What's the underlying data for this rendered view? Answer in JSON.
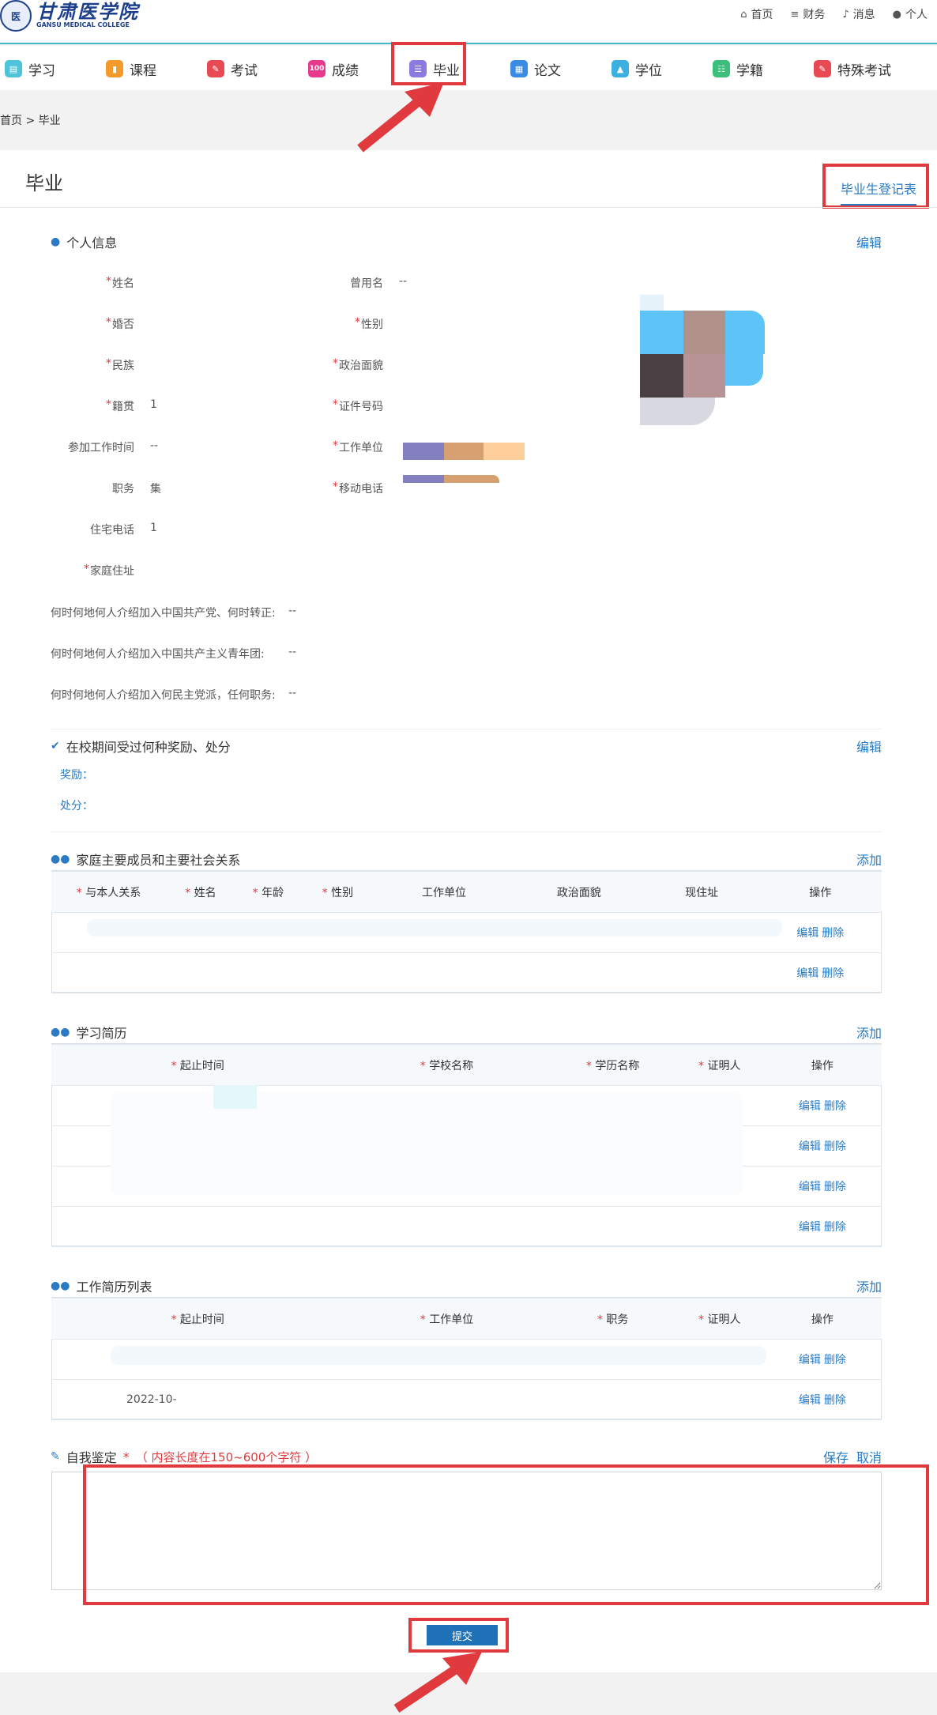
{
  "header": {
    "logo_cn": "甘肃医学院",
    "logo_en": "GANSU MEDICAL COLLEGE",
    "links": [
      {
        "label": "首页",
        "icon": "home-icon"
      },
      {
        "label": "财务",
        "icon": "database-icon"
      },
      {
        "label": "消息",
        "icon": "bell-icon"
      },
      {
        "label": "个人",
        "icon": "user-icon"
      }
    ]
  },
  "nav": {
    "items": [
      {
        "label": "学习",
        "icon": "book-icon",
        "color": "#4fc3d9"
      },
      {
        "label": "课程",
        "icon": "bookmark-icon",
        "color": "#f39a2b"
      },
      {
        "label": "考试",
        "icon": "pencil-icon",
        "color": "#e84a55"
      },
      {
        "label": "成绩",
        "icon": "score-icon",
        "color": "#e83a8c"
      },
      {
        "label": "毕业",
        "icon": "diploma-icon",
        "color": "#8a7be0"
      },
      {
        "label": "论文",
        "icon": "document-icon",
        "color": "#3b8be5"
      },
      {
        "label": "学位",
        "icon": "graduation-cap-icon",
        "color": "#3cb0e0"
      },
      {
        "label": "学籍",
        "icon": "list-icon",
        "color": "#3cbf7a"
      },
      {
        "label": "特殊考试",
        "icon": "pencil-icon",
        "color": "#e84a55"
      }
    ],
    "active": "毕业"
  },
  "breadcrumb": "首页 > 毕业",
  "page": {
    "title": "毕业",
    "register_link": "毕业生登记表"
  },
  "personal": {
    "title": "个人信息",
    "edit": "编辑",
    "fields_left": [
      {
        "label": "姓名",
        "required": true,
        "value": ""
      },
      {
        "label": "婚否",
        "required": true,
        "value": ""
      },
      {
        "label": "民族",
        "required": true,
        "value": ""
      },
      {
        "label": "籍贯",
        "required": true,
        "value": "1"
      },
      {
        "label": "参加工作时间",
        "required": false,
        "value": "--"
      },
      {
        "label": "职务",
        "required": false,
        "value": "集"
      },
      {
        "label": "住宅电话",
        "required": false,
        "value": "1"
      },
      {
        "label": "家庭住址",
        "required": true,
        "value": ""
      }
    ],
    "fields_right": [
      {
        "label": "曾用名",
        "required": false,
        "value": "--"
      },
      {
        "label": "性别",
        "required": true,
        "value": ""
      },
      {
        "label": "政治面貌",
        "required": true,
        "value": ""
      },
      {
        "label": "证件号码",
        "required": true,
        "value": ""
      },
      {
        "label": "工作单位",
        "required": true,
        "value": ""
      },
      {
        "label": "移动电话",
        "required": true,
        "value": ""
      }
    ],
    "long_fields": [
      {
        "label": "何时何地何人介绍加入中国共产党、何时转正:",
        "value": "--"
      },
      {
        "label": "何时何地何人介绍加入中国共产主义青年团:",
        "value": "--"
      },
      {
        "label": "何时何地何人介绍加入何民主党派，任何职务:",
        "value": "--"
      }
    ]
  },
  "awards": {
    "title": "在校期间受过何种奖励、处分",
    "edit": "编辑",
    "reward_label": "奖励：",
    "punish_label": "处分："
  },
  "family": {
    "title": "家庭主要成员和主要社会关系",
    "add": "添加",
    "columns": [
      "与本人关系",
      "姓名",
      "年龄",
      "性别",
      "工作单位",
      "政治面貌",
      "现住址",
      "操作"
    ],
    "required_cols": [
      true,
      true,
      true,
      true,
      false,
      false,
      false,
      false
    ],
    "rows": [
      {
        "edit": "编辑",
        "delete": "删除"
      },
      {
        "edit": "编辑",
        "delete": "删除"
      }
    ]
  },
  "study": {
    "title": "学习简历",
    "add": "添加",
    "columns": [
      "起止时间",
      "学校名称",
      "学历名称",
      "证明人",
      "操作"
    ],
    "required_cols": [
      true,
      true,
      true,
      true,
      false
    ],
    "rows": [
      {
        "edit": "编辑",
        "delete": "删除"
      },
      {
        "edit": "编辑",
        "delete": "删除"
      },
      {
        "edit": "编辑",
        "delete": "删除"
      },
      {
        "edit": "编辑",
        "delete": "删除"
      }
    ]
  },
  "work": {
    "title": "工作简历列表",
    "add": "添加",
    "columns": [
      "起止时间",
      "工作单位",
      "职务",
      "证明人",
      "操作"
    ],
    "required_cols": [
      true,
      true,
      true,
      true,
      false
    ],
    "rows": [
      {
        "time": "",
        "edit": "编辑",
        "delete": "删除"
      },
      {
        "time": "2022-10-",
        "edit": "编辑",
        "delete": "删除"
      }
    ]
  },
  "self_eval": {
    "title": "自我鉴定",
    "hint": "（ 内容长度在150~600个字符 ）",
    "save": "保存",
    "cancel": "取消",
    "value": ""
  },
  "submit": "提交",
  "colors": {
    "accent": "#2a7bc4",
    "highlight": "#e03a3e",
    "required": "#e03a3e",
    "submit": "#1f72b8"
  }
}
